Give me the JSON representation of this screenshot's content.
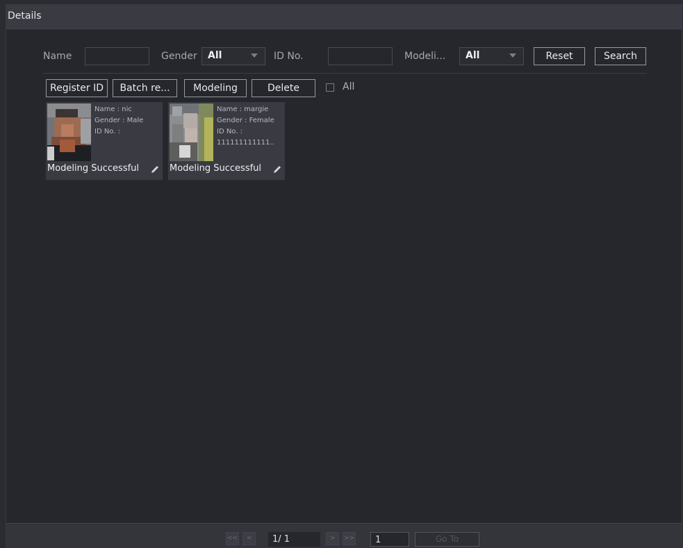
{
  "window": {
    "title": "Details"
  },
  "filters": {
    "name_label": "Name",
    "name_value": "",
    "gender_label": "Gender",
    "gender_value": "All",
    "id_label": "ID No.",
    "id_value": "",
    "modeling_label": "Modeli...",
    "modeling_value": "All",
    "reset_label": "Reset",
    "search_label": "Search"
  },
  "toolbar": {
    "register_label": "Register ID",
    "batch_label": "Batch re...",
    "modeling_label": "Modeling",
    "delete_label": "Delete",
    "all_label": "All"
  },
  "cards": [
    {
      "name": "Name : nic",
      "gender": "Gender : Male",
      "id_label": "ID No. :",
      "id_value": "",
      "status": "Modeling Successful"
    },
    {
      "name": "Name : margie",
      "gender": "Gender : Female",
      "id_label": "ID No. :",
      "id_value": "111111111111..",
      "status": "Modeling Successful"
    }
  ],
  "pagination": {
    "first": "<<",
    "prev": "<",
    "page": "1/ 1",
    "next": ">",
    "last": ">>",
    "goto_value": "1",
    "goto_label": "Go To"
  }
}
